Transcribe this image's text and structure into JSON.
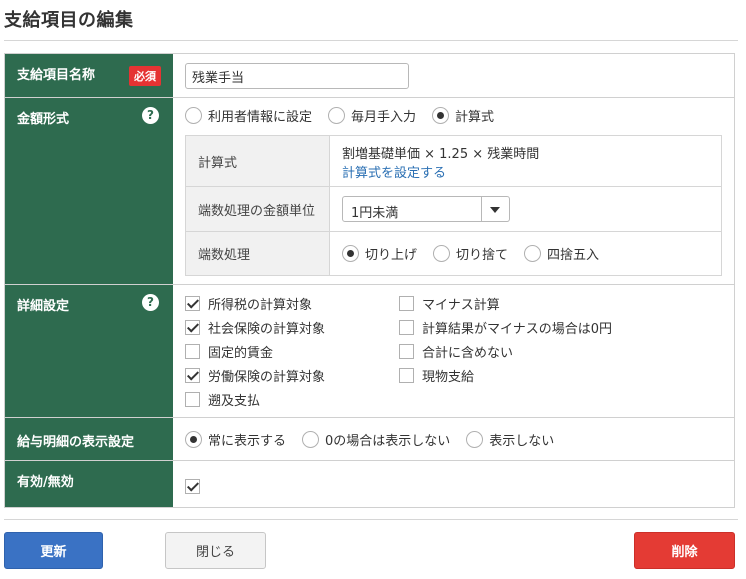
{
  "page": {
    "title": "支給項目の編集"
  },
  "rows": {
    "name": {
      "label": "支給項目名称",
      "required_badge": "必須",
      "input_value": "残業手当"
    },
    "amount_format": {
      "label": "金額形式",
      "help": "?",
      "options": [
        "利用者情報に設定",
        "毎月手入力",
        "計算式"
      ],
      "selected_index": 2,
      "formula": {
        "label": "計算式",
        "expression": "割増基礎単価 × 1.25 × 残業時間",
        "set_link": "計算式を設定する"
      },
      "rounding_unit": {
        "label": "端数処理の金額単位",
        "selected": "1円未満"
      },
      "rounding": {
        "label": "端数処理",
        "options": [
          "切り上げ",
          "切り捨て",
          "四捨五入"
        ],
        "selected_index": 0
      }
    },
    "details": {
      "label": "詳細設定",
      "help": "?",
      "left_checks": [
        {
          "label": "所得税の計算対象",
          "checked": true
        },
        {
          "label": "社会保険の計算対象",
          "checked": true
        },
        {
          "label": "固定的賃金",
          "checked": false
        },
        {
          "label": "労働保険の計算対象",
          "checked": true
        },
        {
          "label": "遡及支払",
          "checked": false
        }
      ],
      "right_checks": [
        {
          "label": "マイナス計算",
          "checked": false
        },
        {
          "label": "計算結果がマイナスの場合は0円",
          "checked": false
        },
        {
          "label": "合計に含めない",
          "checked": false
        },
        {
          "label": "現物支給",
          "checked": false
        }
      ]
    },
    "payslip_display": {
      "label": "給与明細の表示設定",
      "options": [
        "常に表示する",
        "0の場合は表示しない",
        "表示しない"
      ],
      "selected_index": 0
    },
    "enabled": {
      "label": "有効/無効",
      "checked": true
    }
  },
  "buttons": {
    "update": "更新",
    "close": "閉じる",
    "delete": "削除"
  },
  "colors": {
    "label_bg": "#2e6b4f",
    "update_btn": "#3a72c4",
    "delete_btn": "#e43b34",
    "required_badge": "#e53333",
    "link": "#2a6fb3"
  }
}
